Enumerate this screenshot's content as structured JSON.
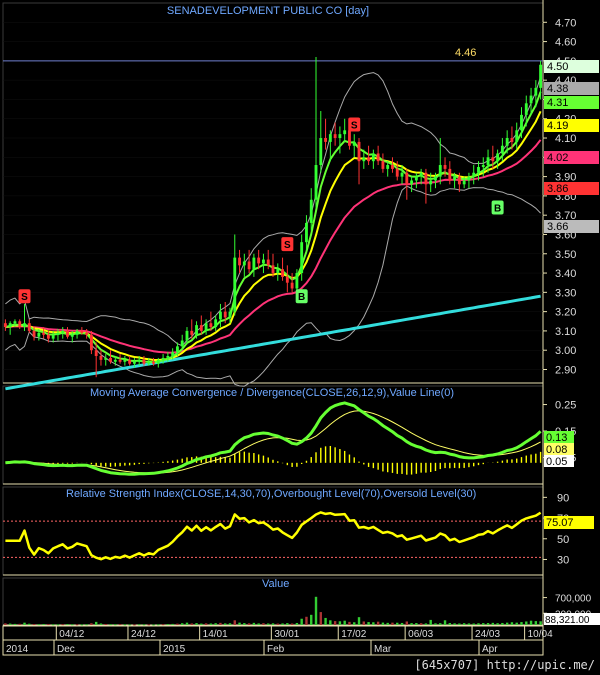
{
  "colors": {
    "background": "#000000",
    "grid": "#3a3a3a",
    "panel_border": "#e8e0b0",
    "title": "#6fa8ff",
    "up_candle": "#33ff33",
    "down_candle": "#ff3333",
    "ema_short": "#ffff00",
    "ema_mid": "#66ff33",
    "ema_long": "#ff3377",
    "sma_long": "#33dddd",
    "bollinger": "#aaaaaa",
    "macd_line": "#66ff33",
    "signal_line": "#ffff66",
    "macd_hist": "#ffff00",
    "rsi_line": "#ffff00",
    "level_line": "#ff6666",
    "volume_bar": "#33cc33"
  },
  "watermark": "[645x707] http://upic.me/",
  "chart_data": {
    "type": "candlestick",
    "title": "SENADEVELOPMENT PUBLIC CO [day]",
    "x_tick_labels": [
      "04/12",
      "24/12",
      "14/01",
      "30/01",
      "17/02",
      "06/03",
      "24/03",
      "10/04"
    ],
    "x_period_labels": [
      "2014",
      "Dec",
      "2015",
      "Feb",
      "Mar",
      "Apr"
    ],
    "price_panel": {
      "ylim": [
        2.83,
        4.8
      ],
      "y_ticks": [
        2.9,
        3.0,
        3.1,
        3.2,
        3.3,
        3.4,
        3.5,
        3.6,
        3.7,
        3.8,
        3.9,
        4.0,
        4.1,
        4.2,
        4.3,
        4.4,
        4.5,
        4.6,
        4.7
      ],
      "reference_line": {
        "value": 4.46,
        "label": "4.46"
      },
      "price_badges": [
        {
          "label": "4.50",
          "color": "#ddffdd"
        },
        {
          "label": "4.38",
          "color": "#aaaaaa"
        },
        {
          "label": "4.31",
          "color": "#66ff33"
        },
        {
          "label": "4.19",
          "color": "#ffff00"
        },
        {
          "label": "4.02",
          "color": "#ff3377"
        },
        {
          "label": "3.86",
          "color": "#ff3333"
        },
        {
          "label": "3.66",
          "color": "#bbbbbb"
        }
      ],
      "signals": [
        {
          "label": "S",
          "day": 4,
          "price": 3.28
        },
        {
          "label": "B",
          "day": 62,
          "price": 3.28
        },
        {
          "label": "S",
          "day": 59,
          "price": 3.55
        },
        {
          "label": "S",
          "day": 73,
          "price": 4.17
        },
        {
          "label": "B",
          "day": 103,
          "price": 3.74
        }
      ],
      "ohlc": [
        [
          3.14,
          3.16,
          3.1,
          3.12
        ],
        [
          3.12,
          3.15,
          3.08,
          3.14
        ],
        [
          3.14,
          3.16,
          3.12,
          3.15
        ],
        [
          3.15,
          3.16,
          3.11,
          3.12
        ],
        [
          3.12,
          3.24,
          3.1,
          3.14
        ],
        [
          3.14,
          3.16,
          3.09,
          3.1
        ],
        [
          3.1,
          3.12,
          3.05,
          3.07
        ],
        [
          3.07,
          3.11,
          3.05,
          3.09
        ],
        [
          3.09,
          3.12,
          3.06,
          3.08
        ],
        [
          3.08,
          3.1,
          3.04,
          3.06
        ],
        [
          3.06,
          3.1,
          3.04,
          3.08
        ],
        [
          3.08,
          3.11,
          3.05,
          3.09
        ],
        [
          3.09,
          3.12,
          3.06,
          3.1
        ],
        [
          3.1,
          3.12,
          3.06,
          3.07
        ],
        [
          3.07,
          3.1,
          3.04,
          3.08
        ],
        [
          3.08,
          3.11,
          3.06,
          3.1
        ],
        [
          3.1,
          3.12,
          3.08,
          3.09
        ],
        [
          3.09,
          3.11,
          3.06,
          3.08
        ],
        [
          3.08,
          3.1,
          2.98,
          3.0
        ],
        [
          3.0,
          3.04,
          2.86,
          2.97
        ],
        [
          2.97,
          3.0,
          2.92,
          2.95
        ],
        [
          2.95,
          2.98,
          2.92,
          2.96
        ],
        [
          2.96,
          3.0,
          2.93,
          2.94
        ],
        [
          2.94,
          2.97,
          2.92,
          2.95
        ],
        [
          2.95,
          2.98,
          2.93,
          2.94
        ],
        [
          2.94,
          2.97,
          2.92,
          2.95
        ],
        [
          2.95,
          2.97,
          2.92,
          2.93
        ],
        [
          2.93,
          2.96,
          2.91,
          2.94
        ],
        [
          2.94,
          2.97,
          2.92,
          2.95
        ],
        [
          2.95,
          2.97,
          2.92,
          2.93
        ],
        [
          2.93,
          2.96,
          2.92,
          2.94
        ],
        [
          2.94,
          2.96,
          2.92,
          2.93
        ],
        [
          2.93,
          2.96,
          2.91,
          2.95
        ],
        [
          2.95,
          2.98,
          2.93,
          2.96
        ],
        [
          2.96,
          2.99,
          2.94,
          2.97
        ],
        [
          2.97,
          3.01,
          2.95,
          2.99
        ],
        [
          2.99,
          3.04,
          2.97,
          3.02
        ],
        [
          3.02,
          3.08,
          3.0,
          3.05
        ],
        [
          3.05,
          3.12,
          3.03,
          3.1
        ],
        [
          3.1,
          3.16,
          3.06,
          3.08
        ],
        [
          3.08,
          3.15,
          3.06,
          3.13
        ],
        [
          3.13,
          3.18,
          3.08,
          3.1
        ],
        [
          3.1,
          3.16,
          3.08,
          3.14
        ],
        [
          3.14,
          3.2,
          3.1,
          3.12
        ],
        [
          3.12,
          3.18,
          3.1,
          3.16
        ],
        [
          3.16,
          3.24,
          3.12,
          3.2
        ],
        [
          3.2,
          3.25,
          3.14,
          3.17
        ],
        [
          3.17,
          3.22,
          3.14,
          3.2
        ],
        [
          3.2,
          3.6,
          3.18,
          3.48
        ],
        [
          3.48,
          3.52,
          3.4,
          3.44
        ],
        [
          3.44,
          3.5,
          3.38,
          3.46
        ],
        [
          3.46,
          3.52,
          3.4,
          3.42
        ],
        [
          3.42,
          3.5,
          3.38,
          3.48
        ],
        [
          3.48,
          3.52,
          3.42,
          3.45
        ],
        [
          3.45,
          3.5,
          3.4,
          3.47
        ],
        [
          3.47,
          3.52,
          3.42,
          3.44
        ],
        [
          3.44,
          3.5,
          3.38,
          3.4
        ],
        [
          3.4,
          3.45,
          3.36,
          3.42
        ],
        [
          3.42,
          3.48,
          3.36,
          3.38
        ],
        [
          3.38,
          3.44,
          3.3,
          3.35
        ],
        [
          3.35,
          3.4,
          3.3,
          3.32
        ],
        [
          3.32,
          3.42,
          3.28,
          3.4
        ],
        [
          3.4,
          3.6,
          3.36,
          3.56
        ],
        [
          3.56,
          3.7,
          3.52,
          3.66
        ],
        [
          3.66,
          3.84,
          3.62,
          3.78
        ],
        [
          3.78,
          4.52,
          3.74,
          3.96
        ],
        [
          3.96,
          4.24,
          3.92,
          4.1
        ],
        [
          4.1,
          4.2,
          4.04,
          4.08
        ],
        [
          4.08,
          4.14,
          3.98,
          4.12
        ],
        [
          4.12,
          4.18,
          4.06,
          4.1
        ],
        [
          4.1,
          4.16,
          4.02,
          4.12
        ],
        [
          4.12,
          4.2,
          4.08,
          4.14
        ],
        [
          4.14,
          4.18,
          4.04,
          4.06
        ],
        [
          4.06,
          4.12,
          4.0,
          4.08
        ],
        [
          4.08,
          4.1,
          3.86,
          3.98
        ],
        [
          3.98,
          4.04,
          3.94,
          4.0
        ],
        [
          4.0,
          4.06,
          3.96,
          3.98
        ],
        [
          3.98,
          4.04,
          3.94,
          4.02
        ],
        [
          4.02,
          4.06,
          3.96,
          3.98
        ],
        [
          3.98,
          4.02,
          3.92,
          3.94
        ],
        [
          3.94,
          3.98,
          3.9,
          3.96
        ],
        [
          3.96,
          4.0,
          3.92,
          3.94
        ],
        [
          3.94,
          3.98,
          3.88,
          3.9
        ],
        [
          3.9,
          3.96,
          3.86,
          3.92
        ],
        [
          3.92,
          3.94,
          3.78,
          3.86
        ],
        [
          3.86,
          3.9,
          3.82,
          3.88
        ],
        [
          3.88,
          3.92,
          3.84,
          3.9
        ],
        [
          3.9,
          3.94,
          3.86,
          3.92
        ],
        [
          3.92,
          3.94,
          3.76,
          3.86
        ],
        [
          3.86,
          3.92,
          3.82,
          3.88
        ],
        [
          3.88,
          3.92,
          3.84,
          3.9
        ],
        [
          3.9,
          4.1,
          3.86,
          3.96
        ],
        [
          3.96,
          4.0,
          3.9,
          3.94
        ],
        [
          3.94,
          3.98,
          3.86,
          3.88
        ],
        [
          3.88,
          3.92,
          3.84,
          3.9
        ],
        [
          3.9,
          3.92,
          3.82,
          3.86
        ],
        [
          3.86,
          3.9,
          3.84,
          3.88
        ],
        [
          3.88,
          3.92,
          3.84,
          3.9
        ],
        [
          3.9,
          3.96,
          3.86,
          3.92
        ],
        [
          3.92,
          3.98,
          3.88,
          3.95
        ],
        [
          3.95,
          4.0,
          3.9,
          3.96
        ],
        [
          3.96,
          4.04,
          3.92,
          4.0
        ],
        [
          4.0,
          4.06,
          3.94,
          3.98
        ],
        [
          3.98,
          4.04,
          3.94,
          4.02
        ],
        [
          4.02,
          4.1,
          3.98,
          4.06
        ],
        [
          4.06,
          4.14,
          4.02,
          4.1
        ],
        [
          4.1,
          4.16,
          4.04,
          4.08
        ],
        [
          4.08,
          4.18,
          4.04,
          4.14
        ],
        [
          4.14,
          4.26,
          4.1,
          4.22
        ],
        [
          4.22,
          4.32,
          4.16,
          4.28
        ],
        [
          4.28,
          4.36,
          4.22,
          4.32
        ],
        [
          4.32,
          4.4,
          4.26,
          4.36
        ],
        [
          4.36,
          4.5,
          4.3,
          4.48
        ]
      ]
    },
    "macd_panel": {
      "title": "Moving Average Convergence / Divergence(CLOSE,26,12,9),Value Line(0)",
      "ylim": [
        -0.05,
        0.32
      ],
      "y_ticks": [
        0.25,
        0.15,
        0.05
      ],
      "badges": [
        {
          "label": "0.13",
          "color": "#66ff33"
        },
        {
          "label": "0.08",
          "color": "#ffff66"
        },
        {
          "label": "0.05",
          "color": "#ffffff"
        }
      ]
    },
    "rsi_panel": {
      "title": "Relative Strength Index(CLOSE,14,30,70),Overbought Level(70),Oversold Level(30)",
      "ylim": [
        15,
        100
      ],
      "y_ticks": [
        90,
        70,
        50,
        30
      ],
      "overbought": 70,
      "oversold": 30,
      "badge": {
        "label": "75.07",
        "color": "#ffff00"
      }
    },
    "volume_panel": {
      "title": "Value",
      "ylim": [
        0,
        1200000
      ],
      "y_ticks": [
        700000,
        300000
      ],
      "y_tick_labels": [
        "700,000",
        "300,000"
      ],
      "badge": {
        "label": "88,321.00",
        "color": "#ffffff"
      },
      "values": [
        42000,
        35000,
        28000,
        30000,
        60000,
        32000,
        25000,
        22000,
        26000,
        24000,
        20000,
        18000,
        22000,
        25000,
        20000,
        18000,
        16000,
        20000,
        45000,
        80000,
        38000,
        26000,
        22000,
        20000,
        24000,
        18000,
        16000,
        15000,
        20000,
        18000,
        16000,
        14000,
        18000,
        22000,
        25000,
        28000,
        34000,
        45000,
        60000,
        40000,
        48000,
        36000,
        42000,
        38000,
        46000,
        55000,
        40000,
        44000,
        120000,
        60000,
        48000,
        42000,
        55000,
        40000,
        46000,
        38000,
        42000,
        36000,
        40000,
        48000,
        38000,
        52000,
        160000,
        210000,
        260000,
        720000,
        330000,
        180000,
        120000,
        100000,
        95000,
        110000,
        80000,
        70000,
        200000,
        90000,
        75000,
        70000,
        85000,
        62000,
        55000,
        60000,
        58000,
        52000,
        90000,
        48000,
        50000,
        46000,
        40000,
        130000,
        42000,
        46000,
        120000,
        50000,
        42000,
        38000,
        46000,
        40000,
        38000,
        44000,
        48000,
        50000,
        55000,
        46000,
        52000,
        60000,
        70000,
        60000,
        75000,
        90000,
        110000,
        100000,
        95000,
        88321
      ]
    }
  }
}
